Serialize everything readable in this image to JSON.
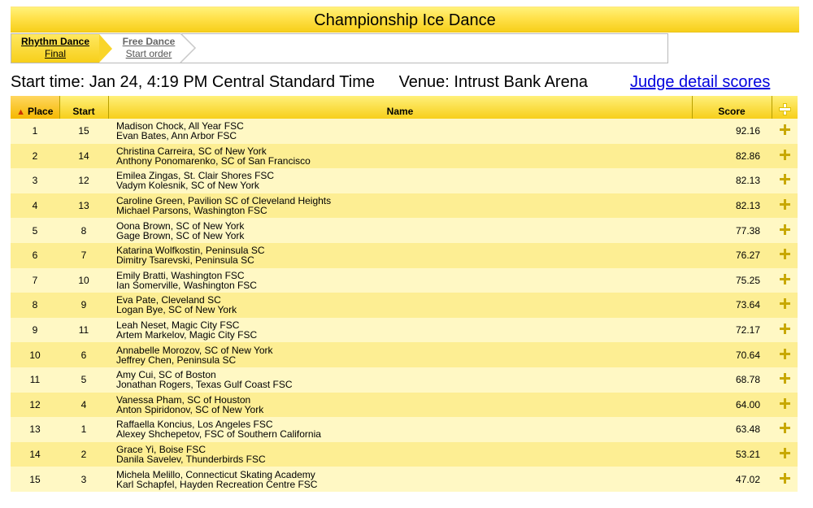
{
  "title": "Championship Ice Dance",
  "tabs": [
    {
      "label": "Rhythm Dance",
      "sub": "Final"
    },
    {
      "label": "Free Dance",
      "sub": "Start order"
    }
  ],
  "info": {
    "start_time": "Start time: Jan 24, 4:19 PM Central Standard Time",
    "venue": "Venue: Intrust Bank Arena",
    "judge_link": "Judge detail scores"
  },
  "headers": {
    "place": "Place",
    "start": "Start",
    "name": "Name",
    "score": "Score"
  },
  "rows": [
    {
      "place": "1",
      "start": "15",
      "line1": "Madison Chock, All Year FSC",
      "line2": "Evan Bates, Ann Arbor FSC",
      "score": "92.16"
    },
    {
      "place": "2",
      "start": "14",
      "line1": "Christina Carreira, SC of New York",
      "line2": "Anthony Ponomarenko, SC of San Francisco",
      "score": "82.86"
    },
    {
      "place": "3",
      "start": "12",
      "line1": "Emilea Zingas, St. Clair Shores FSC",
      "line2": "Vadym Kolesnik, SC of New York",
      "score": "82.13"
    },
    {
      "place": "4",
      "start": "13",
      "line1": "Caroline Green, Pavilion SC of Cleveland Heights",
      "line2": "Michael Parsons, Washington FSC",
      "score": "82.13"
    },
    {
      "place": "5",
      "start": "8",
      "line1": "Oona Brown, SC of New York",
      "line2": "Gage Brown, SC of New York",
      "score": "77.38"
    },
    {
      "place": "6",
      "start": "7",
      "line1": "Katarina Wolfkostin, Peninsula SC",
      "line2": "Dimitry Tsarevski, Peninsula SC",
      "score": "76.27"
    },
    {
      "place": "7",
      "start": "10",
      "line1": "Emily Bratti, Washington FSC",
      "line2": "Ian Somerville, Washington FSC",
      "score": "75.25"
    },
    {
      "place": "8",
      "start": "9",
      "line1": "Eva Pate, Cleveland SC",
      "line2": "Logan Bye, SC of New York",
      "score": "73.64"
    },
    {
      "place": "9",
      "start": "11",
      "line1": "Leah Neset, Magic City FSC",
      "line2": "Artem Markelov, Magic City FSC",
      "score": "72.17"
    },
    {
      "place": "10",
      "start": "6",
      "line1": "Annabelle Morozov, SC of New York",
      "line2": "Jeffrey Chen, Peninsula SC",
      "score": "70.64"
    },
    {
      "place": "11",
      "start": "5",
      "line1": "Amy Cui, SC of Boston",
      "line2": "Jonathan Rogers, Texas Gulf Coast FSC",
      "score": "68.78"
    },
    {
      "place": "12",
      "start": "4",
      "line1": "Vanessa Pham, SC of Houston",
      "line2": "Anton Spiridonov, SC of New York",
      "score": "64.00"
    },
    {
      "place": "13",
      "start": "1",
      "line1": "Raffaella Koncius, Los Angeles FSC",
      "line2": "Alexey Shchepetov, FSC of Southern California",
      "score": "63.48"
    },
    {
      "place": "14",
      "start": "2",
      "line1": "Grace Yi, Boise FSC",
      "line2": "Danila Savelev, Thunderbirds FSC",
      "score": "53.21"
    },
    {
      "place": "15",
      "start": "3",
      "line1": "Michela Melillo, Connecticut Skating Academy",
      "line2": "Karl Schapfel, Hayden Recreation Centre FSC",
      "score": "47.02"
    }
  ]
}
